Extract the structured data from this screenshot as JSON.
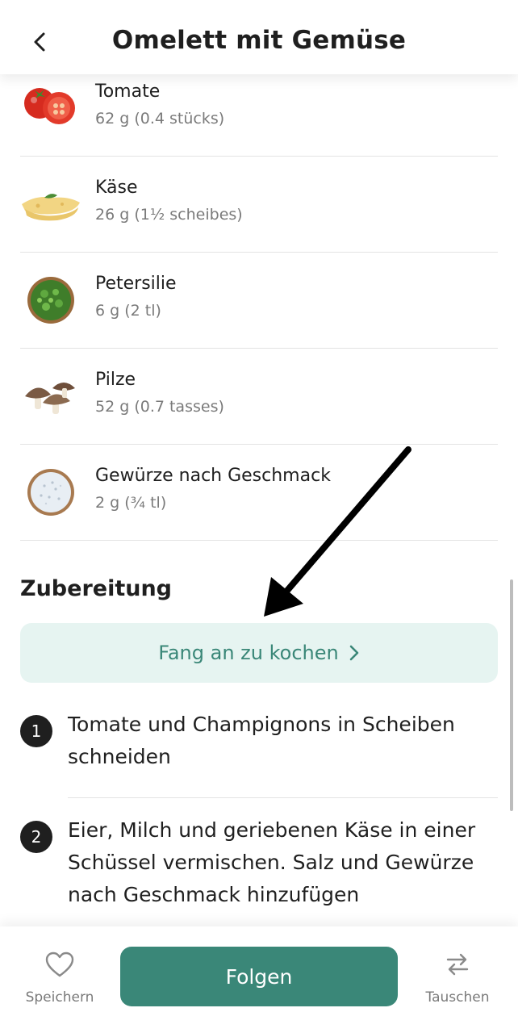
{
  "header": {
    "title": "Omelett mit Gemüse",
    "back_icon": "chevron-left-icon"
  },
  "ingredients": [
    {
      "name": "Tomate",
      "amount": "62 g (0.4 stücks)",
      "icon": "tomato-icon"
    },
    {
      "name": "Käse",
      "amount": "26 g (1½ scheibes)",
      "icon": "cheese-icon"
    },
    {
      "name": "Petersilie",
      "amount": "6 g (2 tl)",
      "icon": "parsley-icon"
    },
    {
      "name": "Pilze",
      "amount": "52 g (0.7 tasses)",
      "icon": "mushroom-icon"
    },
    {
      "name": "Gewürze nach Geschmack",
      "amount": "2 g (¾ tl)",
      "icon": "salt-icon"
    }
  ],
  "preparation": {
    "title": "Zubereitung",
    "start_button": "Fang an zu kochen",
    "steps": [
      {
        "number": "1",
        "text": "Tomate und Champignons in Scheiben schneiden"
      },
      {
        "number": "2",
        "text": "Eier, Milch und geriebenen Käse in einer Schüssel vermischen. Salz und Gewürze nach Geschmack hinzufügen"
      }
    ]
  },
  "bottom_bar": {
    "save_label": "Speichern",
    "follow_label": "Folgen",
    "swap_label": "Tauschen"
  },
  "colors": {
    "accent": "#3a8778",
    "accent_light": "#e6f4f1",
    "text": "#1f1f1f",
    "muted": "#7a7a7a",
    "divider": "#e3e3e3"
  }
}
